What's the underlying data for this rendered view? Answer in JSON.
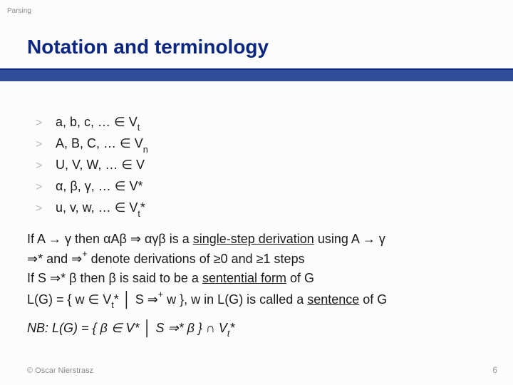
{
  "topic": "Parsing",
  "title": "Notation and terminology",
  "list": [
    {
      "prefix": "a, b, c, … ",
      "rel": "∈",
      "set": " V",
      "sub": "t",
      "suf": ""
    },
    {
      "prefix": "A, B, C, … ",
      "rel": "∈",
      "set": " V",
      "sub": "n",
      "suf": ""
    },
    {
      "prefix": "U, V, W, … ",
      "rel": "∈",
      "set": " V",
      "sub": "",
      "suf": ""
    },
    {
      "prefix": "α, β, γ, … ",
      "rel": "∈",
      "set": " V*",
      "sub": "",
      "suf": ""
    },
    {
      "prefix": "u, v, w, … ",
      "rel": "∈",
      "set": " V",
      "sub": "t",
      "suf": "*"
    }
  ],
  "body": {
    "l1a": "If A ",
    "l1b": " γ then αAβ ",
    "l1c": " αγβ is a ",
    "l1u": "single-step derivation",
    "l1d": " using A ",
    "l1e": " γ",
    "l2a": "* and ",
    "l2b": " denote derivations of ",
    "l2c": "0 and ",
    "l2d": "1 steps",
    "l3a": "If S ",
    "l3b": "* β then β is said to be a ",
    "l3u": "sentential form",
    "l3c": " of G",
    "l4a": "L(G) = { w ",
    "l4b": " V",
    "l4c": "* ",
    "l4d": " S ",
    "l4e": " w }, w in L(G) is called a ",
    "l4u": "sentence",
    "l4f": " of G"
  },
  "nb": {
    "a": "NB: L(G) = { β ",
    "b": " V* ",
    "c": " S ",
    "d": "* β } ",
    "e": " V",
    "f": "*"
  },
  "sym": {
    "arrow": "→",
    "dblArrow": "⇒",
    "plus": "+",
    "ge": "≥",
    "in": "∈",
    "bar": "│",
    "cap": "∩",
    "sub_t": "t"
  },
  "footer": {
    "left": "© Oscar Nierstrasz",
    "right": "6"
  }
}
